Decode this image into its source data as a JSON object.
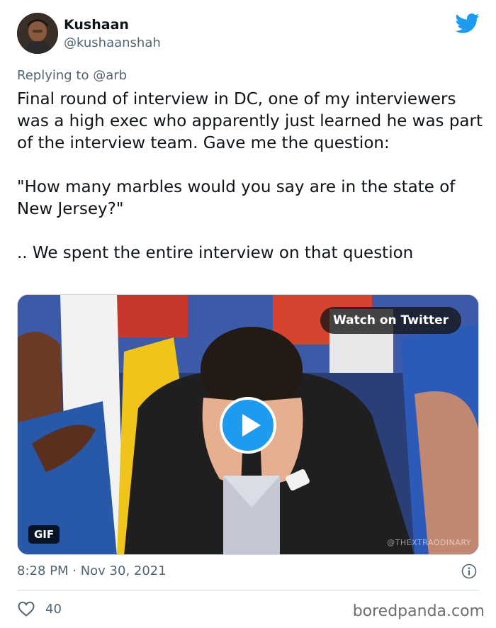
{
  "author": {
    "name": "Kushaan",
    "handle": "@kushaanshah"
  },
  "reply": {
    "prefix": "Replying to",
    "mention": "@arb"
  },
  "tweet": {
    "lines": [
      "Final round of interview in DC, one of my interviewers was a high exec who apparently just learned he was part of the interview team. Gave me the question:",
      "\"How many marbles would you say are in the state of New Jersey?\"",
      ".. We spent the entire interview on that question"
    ]
  },
  "media": {
    "watch_label": "Watch on Twitter",
    "badge": "GIF",
    "watermark": "@THEXTRAODINARY",
    "play_icon": "play-icon"
  },
  "meta": {
    "timestamp": "8:28 PM · Nov 30, 2021",
    "likes": "40"
  },
  "footer": {
    "source": "boredpanda.com"
  },
  "colors": {
    "twitter_blue": "#1d9bf0",
    "text": "#0f1419",
    "muted": "#536471"
  },
  "icons": [
    "twitter-bird-icon",
    "info-icon",
    "heart-icon",
    "play-icon"
  ]
}
